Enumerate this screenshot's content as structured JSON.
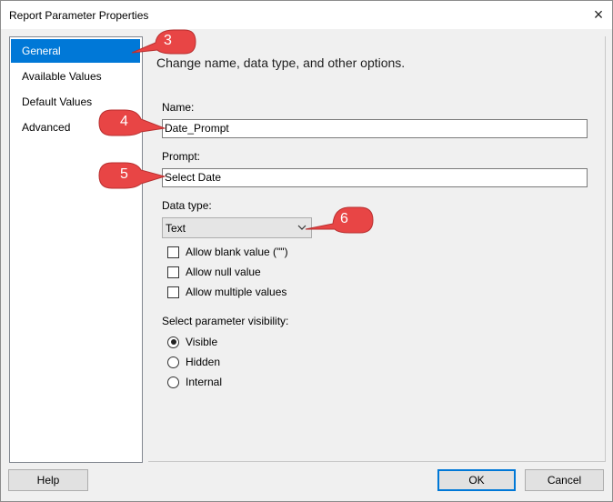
{
  "window": {
    "title": "Report Parameter Properties",
    "close_glyph": "×"
  },
  "nav": {
    "items": [
      {
        "label": "General",
        "selected": true
      },
      {
        "label": "Available Values",
        "selected": false
      },
      {
        "label": "Default Values",
        "selected": false
      },
      {
        "label": "Advanced",
        "selected": false
      }
    ]
  },
  "general": {
    "heading": "Change name, data type, and other options.",
    "name_label": "Name:",
    "name_value": "Date_Prompt",
    "prompt_label": "Prompt:",
    "prompt_value": "Select Date",
    "datatype_label": "Data type:",
    "datatype_value": "Text",
    "checkboxes": [
      {
        "label": "Allow blank value (\"\")",
        "checked": false
      },
      {
        "label": "Allow null value",
        "checked": false
      },
      {
        "label": "Allow multiple values",
        "checked": false
      }
    ],
    "visibility_label": "Select parameter visibility:",
    "visibility_options": [
      {
        "label": "Visible",
        "checked": true
      },
      {
        "label": "Hidden",
        "checked": false
      },
      {
        "label": "Internal",
        "checked": false
      }
    ]
  },
  "buttons": {
    "help": "Help",
    "ok": "OK",
    "cancel": "Cancel"
  },
  "callouts": [
    {
      "number": "3"
    },
    {
      "number": "4"
    },
    {
      "number": "5"
    },
    {
      "number": "6"
    }
  ],
  "colors": {
    "accent": "#0078d7",
    "callout": "#e84545"
  }
}
